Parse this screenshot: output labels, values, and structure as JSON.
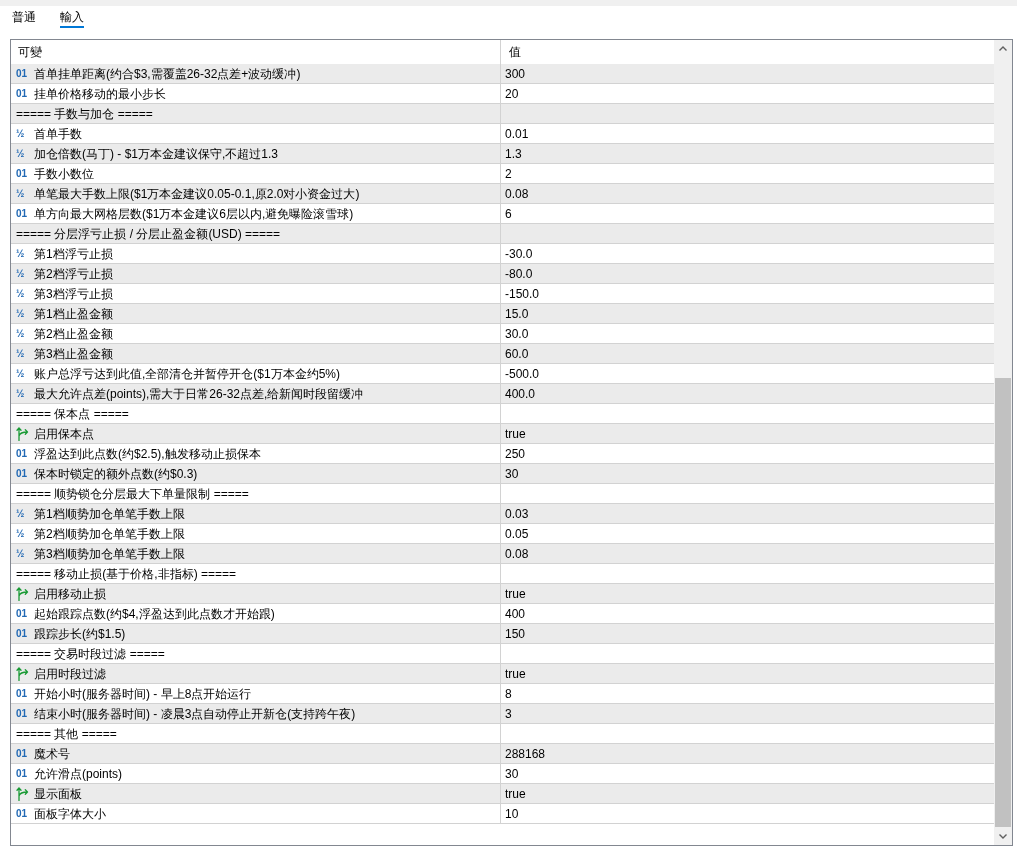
{
  "tabs": [
    {
      "label": "普通",
      "selected": false
    },
    {
      "label": "輸入",
      "selected": true
    }
  ],
  "table": {
    "columns": [
      "可變",
      "值"
    ],
    "rows": [
      {
        "kind": "number",
        "icon": "01",
        "name": "首单挂单距离(约合$3,需覆盖26-32点差+波动缓冲)",
        "value": "300"
      },
      {
        "kind": "number",
        "icon": "01",
        "name": "挂单价格移动的最小步长",
        "value": "20"
      },
      {
        "kind": "section",
        "name": "===== 手数与加仓 ====="
      },
      {
        "kind": "number",
        "icon": "½",
        "name": "首单手数",
        "value": "0.01"
      },
      {
        "kind": "number",
        "icon": "½",
        "name": "加仓倍数(马丁) - $1万本金建议保守,不超过1.3",
        "value": "1.3"
      },
      {
        "kind": "number",
        "icon": "01",
        "name": "手数小数位",
        "value": "2"
      },
      {
        "kind": "number",
        "icon": "½",
        "name": "单笔最大手数上限($1万本金建议0.05-0.1,原2.0对小资金过大)",
        "value": "0.08"
      },
      {
        "kind": "number",
        "icon": "01",
        "name": "单方向最大网格层数($1万本金建议6层以内,避免曝险滚雪球)",
        "value": "6"
      },
      {
        "kind": "section",
        "name": "===== 分层浮亏止损 / 分层止盈金额(USD) ====="
      },
      {
        "kind": "number",
        "icon": "½",
        "name": "第1档浮亏止损",
        "value": "-30.0"
      },
      {
        "kind": "number",
        "icon": "½",
        "name": "第2档浮亏止损",
        "value": "-80.0"
      },
      {
        "kind": "number",
        "icon": "½",
        "name": "第3档浮亏止损",
        "value": "-150.0"
      },
      {
        "kind": "number",
        "icon": "½",
        "name": "第1档止盈金额",
        "value": "15.0"
      },
      {
        "kind": "number",
        "icon": "½",
        "name": "第2档止盈金额",
        "value": "30.0"
      },
      {
        "kind": "number",
        "icon": "½",
        "name": "第3档止盈金额",
        "value": "60.0"
      },
      {
        "kind": "number",
        "icon": "½",
        "name": "账户总浮亏达到此值,全部清仓并暂停开仓($1万本金约5%)",
        "value": "-500.0"
      },
      {
        "kind": "number",
        "icon": "½",
        "name": "最大允许点差(points),需大于日常26-32点差,给新闻时段留缓冲",
        "value": "400.0"
      },
      {
        "kind": "section",
        "name": "===== 保本点 ====="
      },
      {
        "kind": "bool",
        "name": "启用保本点",
        "value": "true"
      },
      {
        "kind": "number",
        "icon": "01",
        "name": "浮盈达到此点数(约$2.5),触发移动止损保本",
        "value": "250"
      },
      {
        "kind": "number",
        "icon": "01",
        "name": "保本时锁定的额外点数(约$0.3)",
        "value": "30"
      },
      {
        "kind": "section",
        "name": "===== 顺势锁仓分层最大下单量限制 ====="
      },
      {
        "kind": "number",
        "icon": "½",
        "name": "第1档顺势加仓单笔手数上限",
        "value": "0.03"
      },
      {
        "kind": "number",
        "icon": "½",
        "name": "第2档顺势加仓单笔手数上限",
        "value": "0.05"
      },
      {
        "kind": "number",
        "icon": "½",
        "name": "第3档顺势加仓单笔手数上限",
        "value": "0.08"
      },
      {
        "kind": "section",
        "name": "===== 移动止损(基于价格,非指标) ====="
      },
      {
        "kind": "bool",
        "name": "启用移动止损",
        "value": "true"
      },
      {
        "kind": "number",
        "icon": "01",
        "name": "起始跟踪点数(约$4,浮盈达到此点数才开始跟)",
        "value": "400"
      },
      {
        "kind": "number",
        "icon": "01",
        "name": "跟踪步长(约$1.5)",
        "value": "150"
      },
      {
        "kind": "section",
        "name": "===== 交易时段过滤 ====="
      },
      {
        "kind": "bool",
        "name": "启用时段过滤",
        "value": "true"
      },
      {
        "kind": "number",
        "icon": "01",
        "name": "开始小时(服务器时间) - 早上8点开始运行",
        "value": "8"
      },
      {
        "kind": "number",
        "icon": "01",
        "name": "结束小时(服务器时间) - 凌晨3点自动停止开新仓(支持跨午夜)",
        "value": "3"
      },
      {
        "kind": "section",
        "name": "===== 其他 ====="
      },
      {
        "kind": "number",
        "icon": "01",
        "name": "魔术号",
        "value": "288168"
      },
      {
        "kind": "number",
        "icon": "01",
        "name": "允许滑点(points)",
        "value": "30"
      },
      {
        "kind": "bool",
        "name": "显示面板",
        "value": "true"
      },
      {
        "kind": "number",
        "icon": "01",
        "name": "面板字体大小",
        "value": "10"
      }
    ]
  }
}
